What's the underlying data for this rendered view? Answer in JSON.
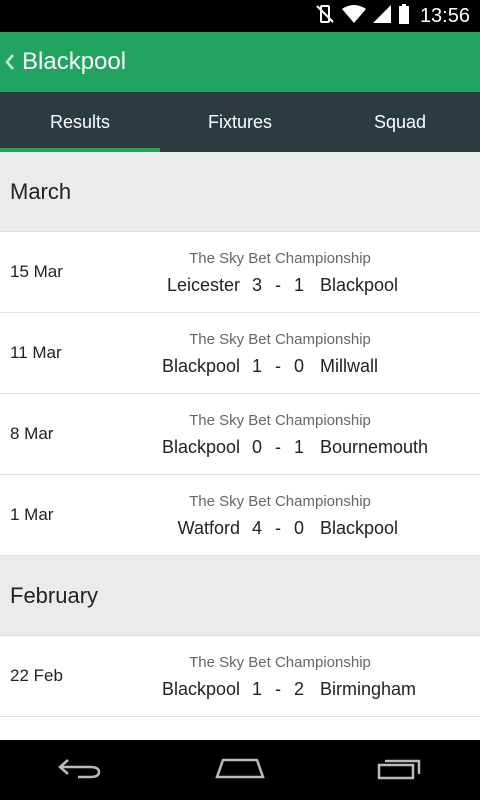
{
  "status_bar": {
    "time": "13:56"
  },
  "app_bar": {
    "title": "Blackpool"
  },
  "tabs": [
    {
      "label": "Results",
      "active": true
    },
    {
      "label": "Fixtures",
      "active": false
    },
    {
      "label": "Squad",
      "active": false
    }
  ],
  "sections": [
    {
      "month": "March",
      "matches": [
        {
          "date": "15 Mar",
          "competition": "The Sky Bet Championship",
          "home": "Leicester",
          "home_score": "3",
          "away_score": "1",
          "away": "Blackpool"
        },
        {
          "date": "11 Mar",
          "competition": "The Sky Bet Championship",
          "home": "Blackpool",
          "home_score": "1",
          "away_score": "0",
          "away": "Millwall"
        },
        {
          "date": "8 Mar",
          "competition": "The Sky Bet Championship",
          "home": "Blackpool",
          "home_score": "0",
          "away_score": "1",
          "away": "Bournemouth"
        },
        {
          "date": "1 Mar",
          "competition": "The Sky Bet Championship",
          "home": "Watford",
          "home_score": "4",
          "away_score": "0",
          "away": "Blackpool"
        }
      ]
    },
    {
      "month": "February",
      "matches": [
        {
          "date": "22 Feb",
          "competition": "The Sky Bet Championship",
          "home": "Blackpool",
          "home_score": "1",
          "away_score": "2",
          "away": "Birmingham"
        }
      ]
    }
  ],
  "score_separator": "-",
  "colors": {
    "accent": "#21a361",
    "tab_bar": "#2b3b40",
    "section_bg": "#ebebeb"
  }
}
